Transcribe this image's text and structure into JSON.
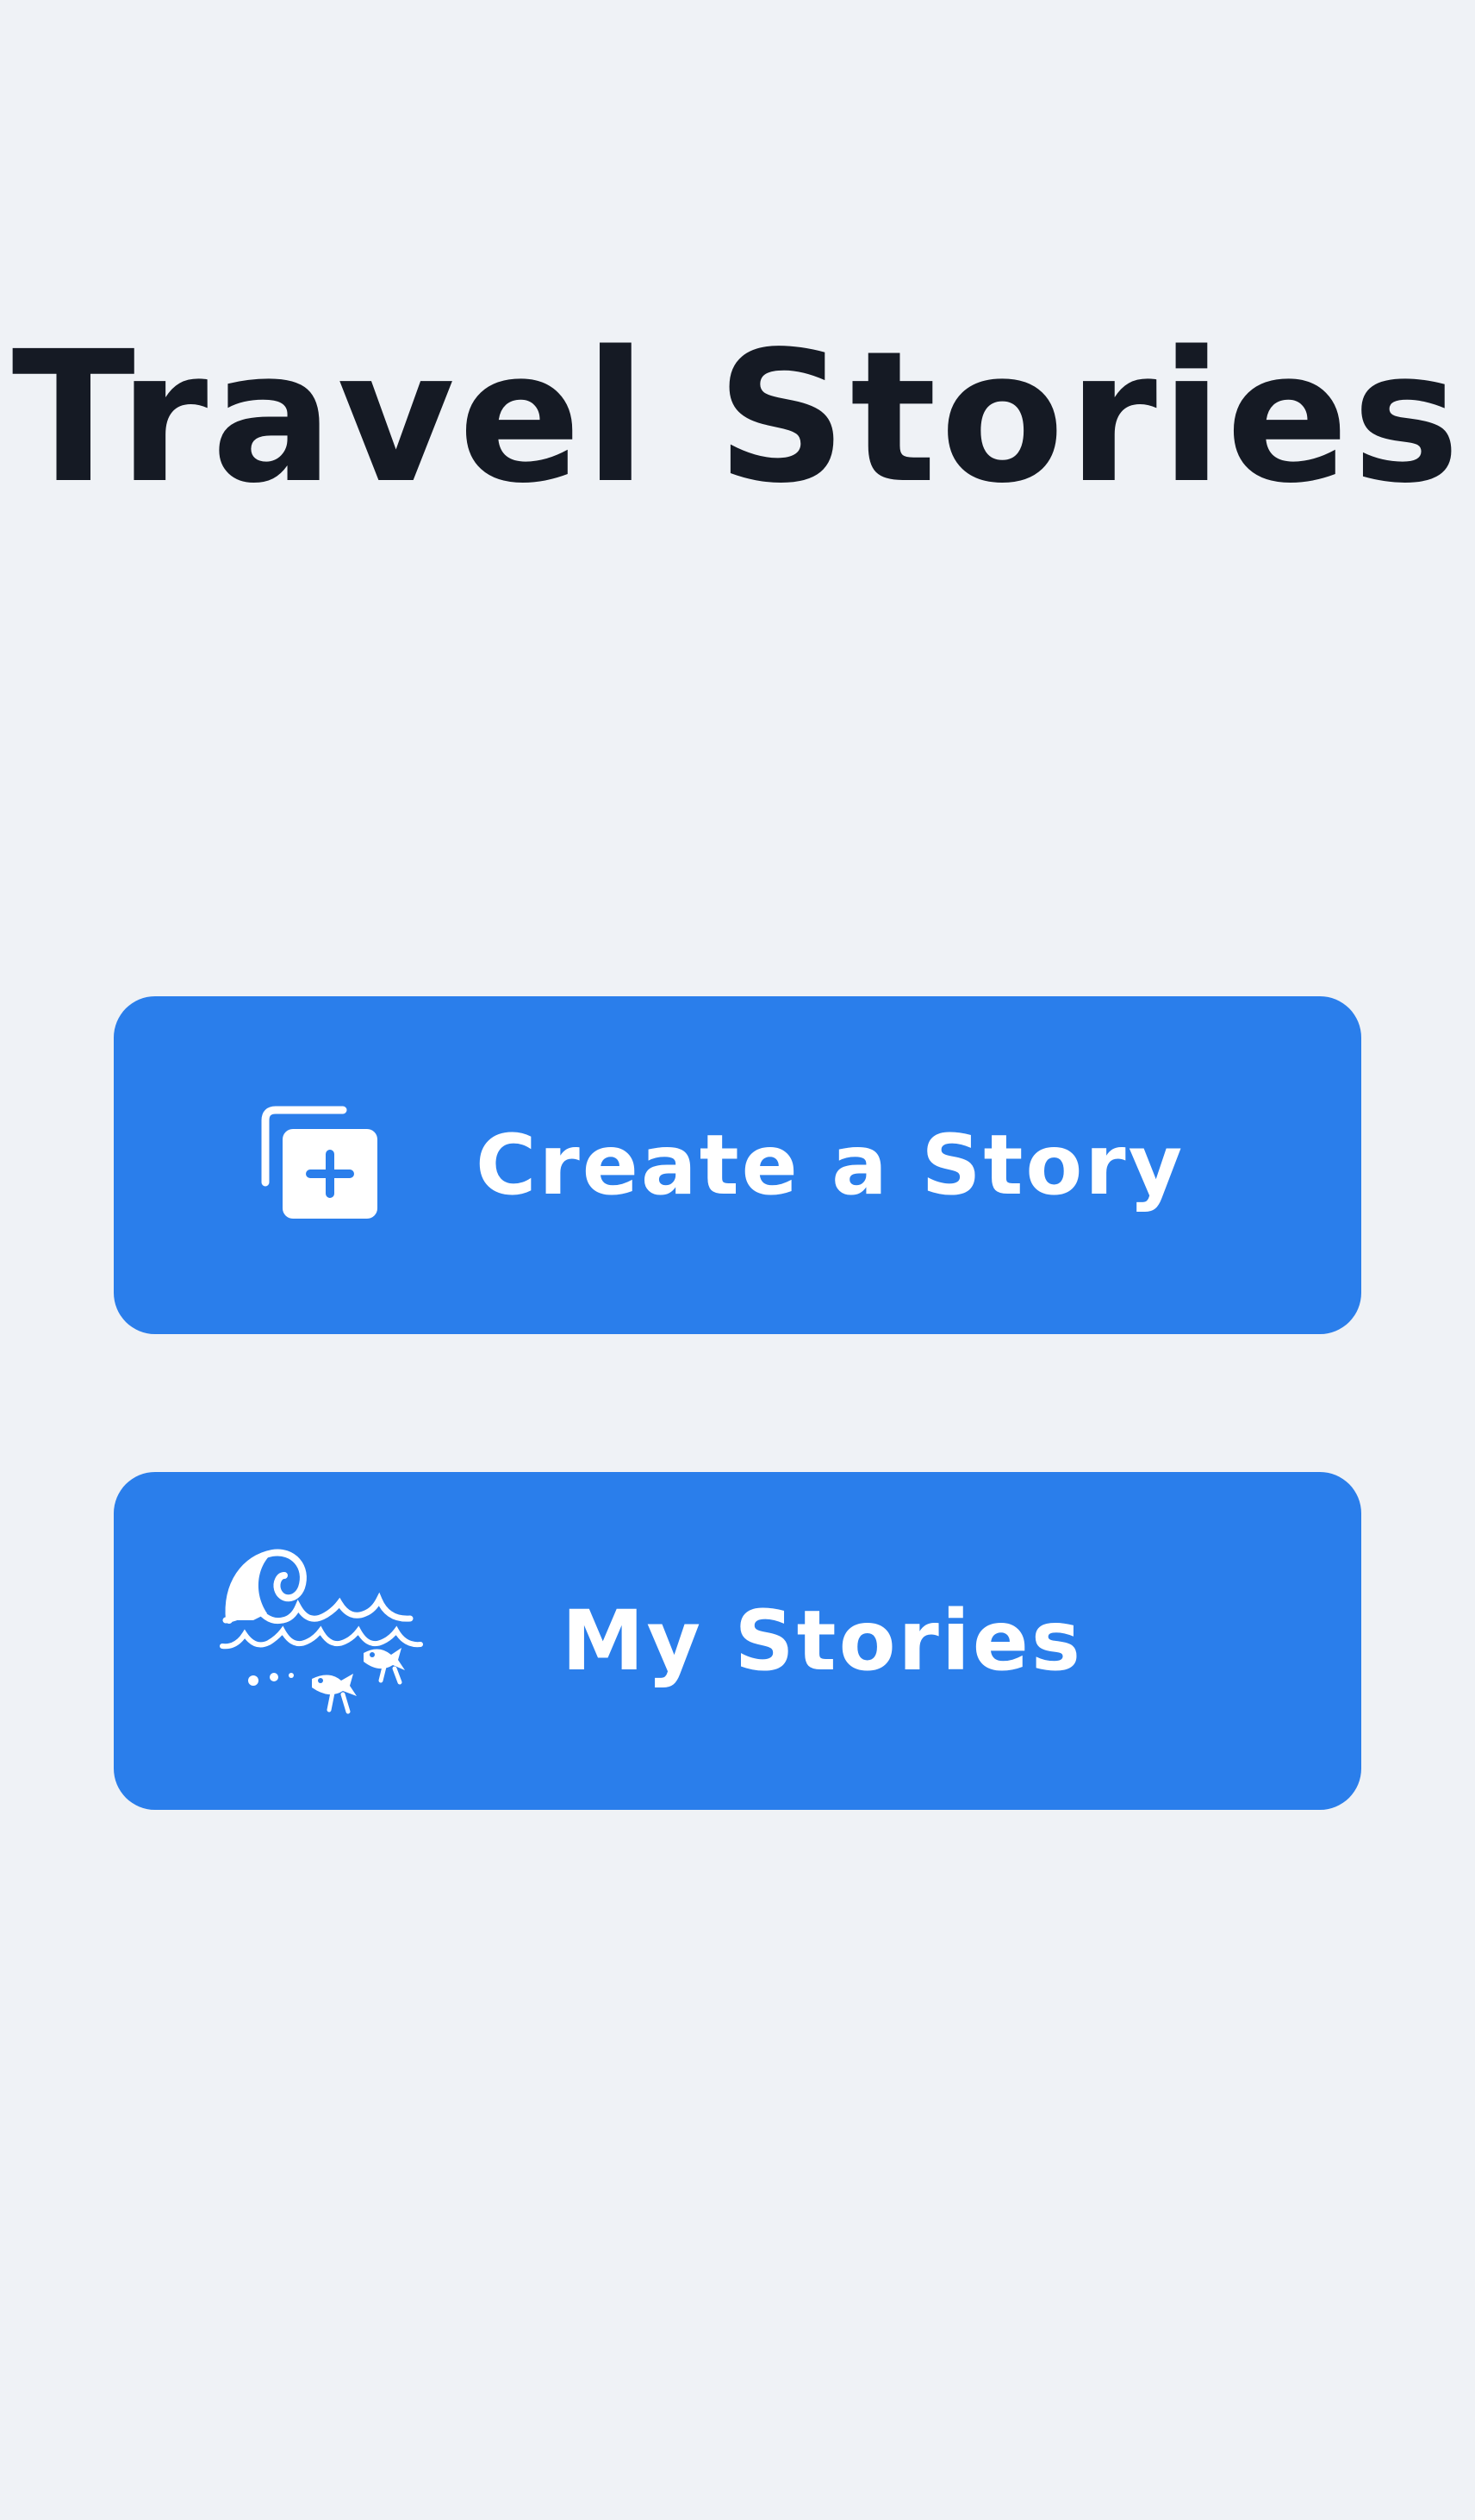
{
  "app": {
    "title": "Travel Stories"
  },
  "actions": {
    "create_label": "Create a Story",
    "stories_label": "My Stories"
  },
  "icons": {
    "create": "add-to-collection-icon",
    "stories": "ocean-waves-fish-icon"
  },
  "colors": {
    "background": "#eff2f6",
    "title_text": "#151a24",
    "button": "#2a7eeb",
    "button_text": "#ffffff"
  }
}
